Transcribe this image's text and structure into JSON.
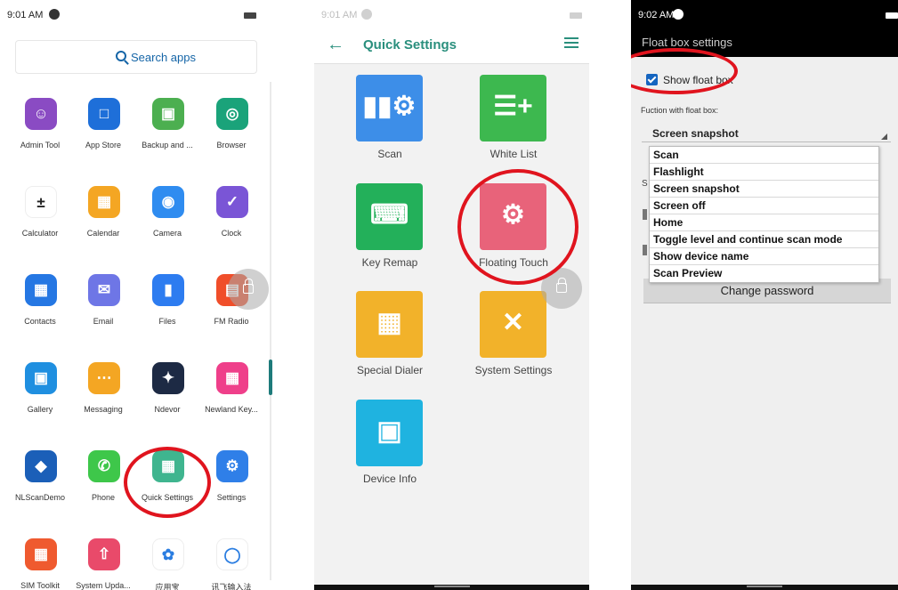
{
  "launcher": {
    "status": {
      "time": "9:01 AM"
    },
    "search_label": "Search apps",
    "apps": [
      {
        "label": "Admin Tool",
        "icon": "admin-user-icon",
        "color": "#8a4bc3"
      },
      {
        "label": "App Store",
        "icon": "shopping-bag-icon",
        "color": "#1e6fd9"
      },
      {
        "label": "Backup and ...",
        "icon": "floppy-disk-icon",
        "color": "#4caf50"
      },
      {
        "label": "Browser",
        "icon": "globe-icon",
        "color": "#1aa37a"
      },
      {
        "label": "Calculator",
        "icon": "calculator-icon",
        "color": "#ffffff"
      },
      {
        "label": "Calendar",
        "icon": "calendar-icon",
        "color": "#f4a623"
      },
      {
        "label": "Camera",
        "icon": "camera-icon",
        "color": "#2f8cf0"
      },
      {
        "label": "Clock",
        "icon": "clock-icon",
        "color": "#7a55d6"
      },
      {
        "label": "Contacts",
        "icon": "contacts-icon",
        "color": "#2577e3"
      },
      {
        "label": "Email",
        "icon": "email-icon",
        "color": "#6e76e6"
      },
      {
        "label": "Files",
        "icon": "folder-icon",
        "color": "#2d7cf0"
      },
      {
        "label": "FM Radio",
        "icon": "radio-icon",
        "color": "#f04e2a"
      },
      {
        "label": "Gallery",
        "icon": "gallery-icon",
        "color": "#1f8fe0"
      },
      {
        "label": "Messaging",
        "icon": "message-icon",
        "color": "#f4a623"
      },
      {
        "label": "Ndevor",
        "icon": "ndevor-icon",
        "color": "#1d2a44"
      },
      {
        "label": "Newland Key...",
        "icon": "keyboard-icon",
        "color": "#ef3f8a"
      },
      {
        "label": "NLScanDemo",
        "icon": "nlscan-icon",
        "color": "#1b5fb8"
      },
      {
        "label": "Phone",
        "icon": "phone-icon",
        "color": "#3ec74a"
      },
      {
        "label": "Quick Settings",
        "icon": "quick-settings-icon",
        "color": "#3fb58f"
      },
      {
        "label": "Settings",
        "icon": "gear-icon",
        "color": "#2f7fe8"
      },
      {
        "label": "SIM Toolkit",
        "icon": "sim-card-icon",
        "color": "#ef5a2f"
      },
      {
        "label": "System Upda...",
        "icon": "cloud-upload-icon",
        "color": "#e94a6a"
      },
      {
        "label": "应用宝",
        "icon": "app-market-icon",
        "color": "#ffffff"
      },
      {
        "label": "讯飞输入法",
        "icon": "ifly-icon",
        "color": "#ffffff"
      }
    ]
  },
  "quick_settings": {
    "status": {
      "time": "9:01 AM"
    },
    "title": "Quick Settings",
    "tiles": [
      {
        "label": "Scan",
        "icon": "barcode-gear-icon",
        "color": "#3d8ee8"
      },
      {
        "label": "White List",
        "icon": "checklist-plus-icon",
        "color": "#3db84f"
      },
      {
        "label": "Key Remap",
        "icon": "keyboard-icon",
        "color": "#23b05a"
      },
      {
        "label": "Floating Touch",
        "icon": "gear-square-icon",
        "color": "#e8637a"
      },
      {
        "label": "Special Dialer",
        "icon": "dial-grid-icon",
        "color": "#f2b22a"
      },
      {
        "label": "System Settings",
        "icon": "tools-icon",
        "color": "#f2b22a"
      },
      {
        "label": "Device Info",
        "icon": "chip-icon",
        "color": "#1fb3e0"
      }
    ]
  },
  "float_box": {
    "status": {
      "time": "9:02 AM"
    },
    "title": "Float box settings",
    "show_float_box_label": "Show float box",
    "show_float_box_checked": true,
    "function_label": "Fuction with float box:",
    "selected_function": "Screen snapshot",
    "options": [
      "Scan",
      "Flashlight",
      "Screen snapshot",
      "Screen off",
      "Home",
      "Toggle level and continue scan mode",
      "Show device name",
      "Scan Preview"
    ],
    "hidden_row_letter": "S",
    "change_password_label": "Change password"
  }
}
